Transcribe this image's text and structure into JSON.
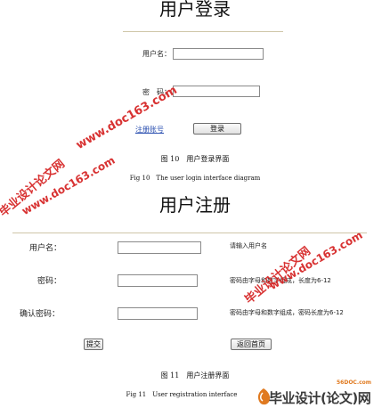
{
  "login": {
    "title": "用户登录",
    "username_label": "用户名：",
    "password_label": "密　码：",
    "register_link": "注册账号",
    "login_button": "登录",
    "caption_cn": "图 10　用户登录界面",
    "caption_en": "Fig 10　The user login interface diagram"
  },
  "register": {
    "title": "用户注册",
    "username_label": "用户名：",
    "password_label": "密码：",
    "confirm_label": "确认密码：",
    "username_hint": "请输入用户名",
    "password_hint": "密码由字母和数字组成，长度为6-12",
    "confirm_hint": "密码由字母和数字组成，密码长度为6-12",
    "submit_button": "提交",
    "back_button": "返回首页",
    "caption_cn": "图 11　用户注册界面",
    "caption_en": "Fig 11　User registration interface"
  },
  "watermarks": {
    "site_top": "www.doc163.com",
    "brand_left": "毕业设计论文网",
    "site_left": "www.doc163.com",
    "brand_right": "毕业设计论文网",
    "site_right": "www.doc163.com"
  },
  "logo": {
    "url": "56DOC.com",
    "text": "毕业设计(论文)网"
  },
  "colors": {
    "watermark": "#d62828",
    "link": "#2a4fb0"
  }
}
